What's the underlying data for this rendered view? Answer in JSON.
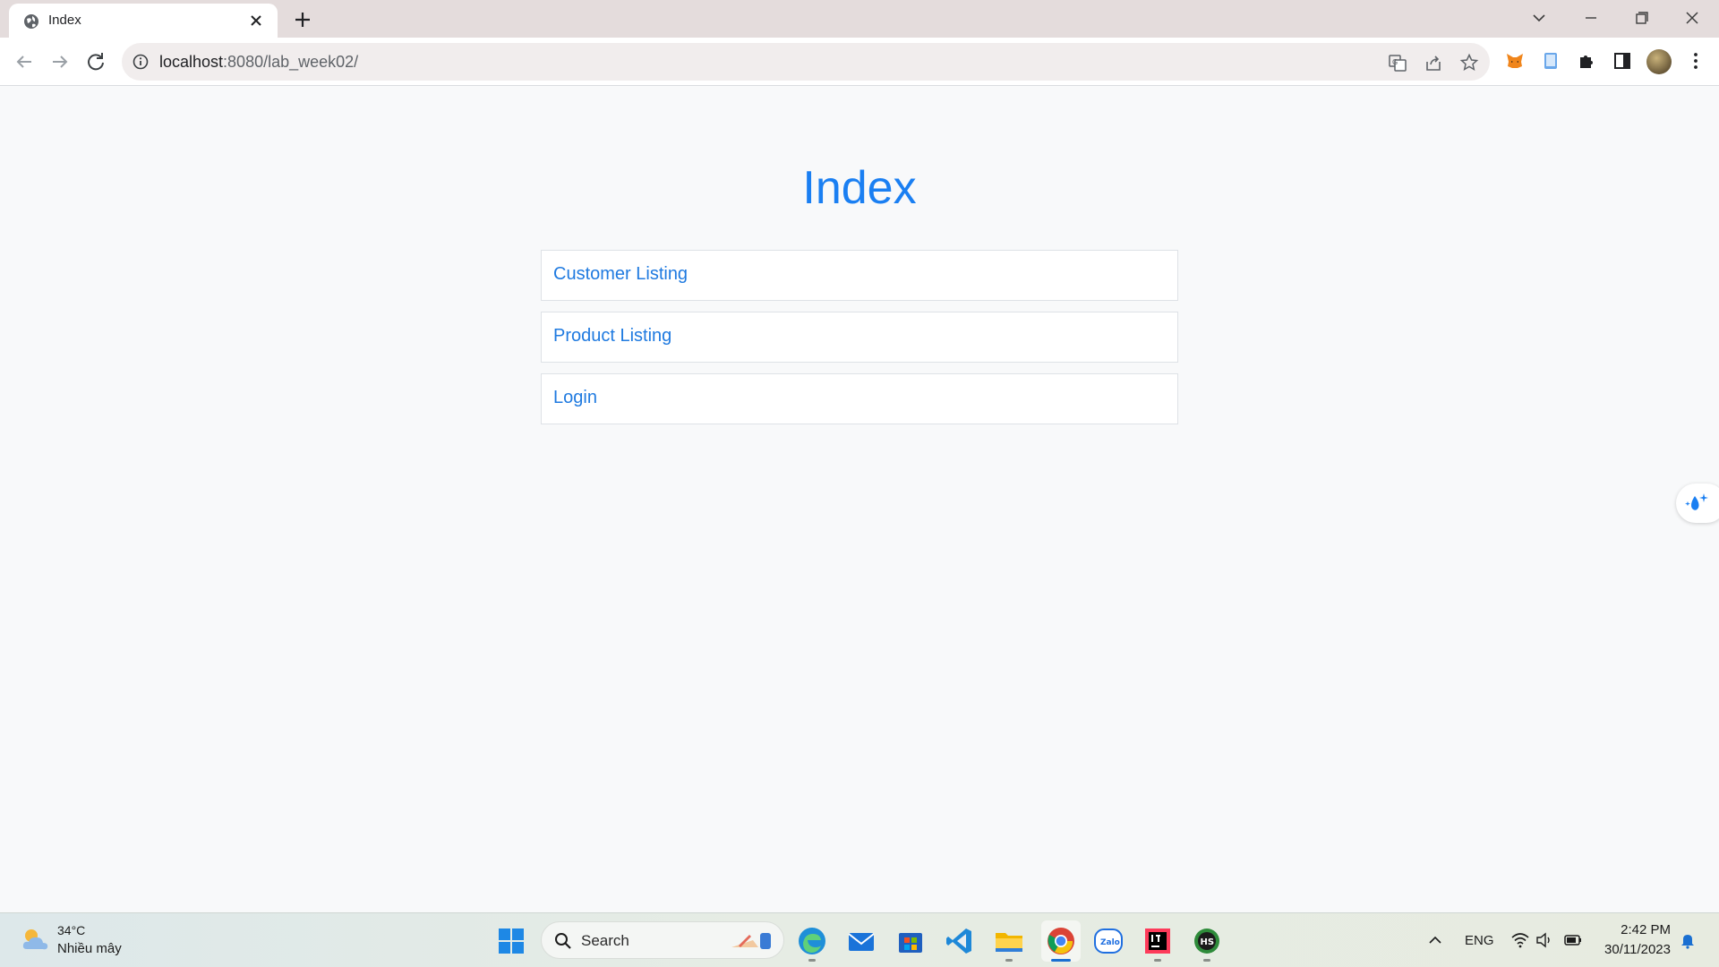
{
  "browser": {
    "tab_title": "Index",
    "url_host": "localhost",
    "url_rest": ":8080/lab_week02/"
  },
  "page": {
    "title": "Index",
    "links": [
      {
        "label": "Customer Listing"
      },
      {
        "label": "Product Listing"
      },
      {
        "label": "Login"
      }
    ],
    "colors": {
      "accent": "#1a7ff2",
      "link": "#1f7ae0",
      "background": "#f8f9fa"
    }
  },
  "taskbar": {
    "weather_temp": "34°C",
    "weather_condition": "Nhiều mây",
    "search_placeholder": "Search",
    "apps": [
      "edge-icon",
      "mail-icon",
      "store-icon",
      "vscode-icon",
      "file-explorer-icon",
      "chrome-icon",
      "zalo-icon",
      "intellij-icon",
      "hs-app-icon"
    ],
    "language": "ENG",
    "time": "2:42 PM",
    "date": "30/11/2023"
  }
}
